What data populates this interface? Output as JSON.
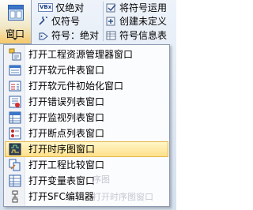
{
  "ribbon": {
    "window_button_label": "窗口",
    "rows": [
      {
        "icon": "vbx-icon",
        "icon_text": "VBx",
        "label": "仅绝对"
      },
      {
        "icon": "wrench-icon",
        "label": "仅符号"
      },
      {
        "icon": "tag-icon",
        "label": "符号：绝对"
      }
    ],
    "rows_right": [
      {
        "icon": "symbol-apply-icon",
        "label": "将符号运用"
      },
      {
        "icon": "create-undefined-icon",
        "label": "创建未定义"
      },
      {
        "icon": "symbol-info-icon",
        "label": "符号信息表"
      }
    ]
  },
  "menu": {
    "items": [
      {
        "label": "打开工程资源管理器窗口",
        "icon": "project-explorer-icon"
      },
      {
        "label": "打开软元件表窗口",
        "icon": "device-table-icon"
      },
      {
        "label": "打开软元件初始化窗口",
        "icon": "device-init-icon"
      },
      {
        "label": "打开错误列表窗口",
        "icon": "error-list-icon"
      },
      {
        "label": "打开监视列表窗口",
        "icon": "watch-list-icon"
      },
      {
        "label": "打开断点列表窗口",
        "icon": "breakpoint-list-icon"
      },
      {
        "label": "打开时序图窗口",
        "icon": "timing-chart-icon",
        "highlighted": true
      },
      {
        "label": "打开工程比较窗口",
        "icon": "project-compare-icon"
      },
      {
        "label": "打开变量表窗口",
        "icon": "variable-table-icon"
      },
      {
        "label": "打开SFC编辑器",
        "icon": "sfc-editor-icon"
      }
    ],
    "ghost_text_1": "序图",
    "ghost_text_2": "打开时序图窗口"
  },
  "colors": {
    "highlight_top": "#fff6c8",
    "highlight_bottom": "#ffe08a",
    "highlight_border": "#e3b84b"
  }
}
